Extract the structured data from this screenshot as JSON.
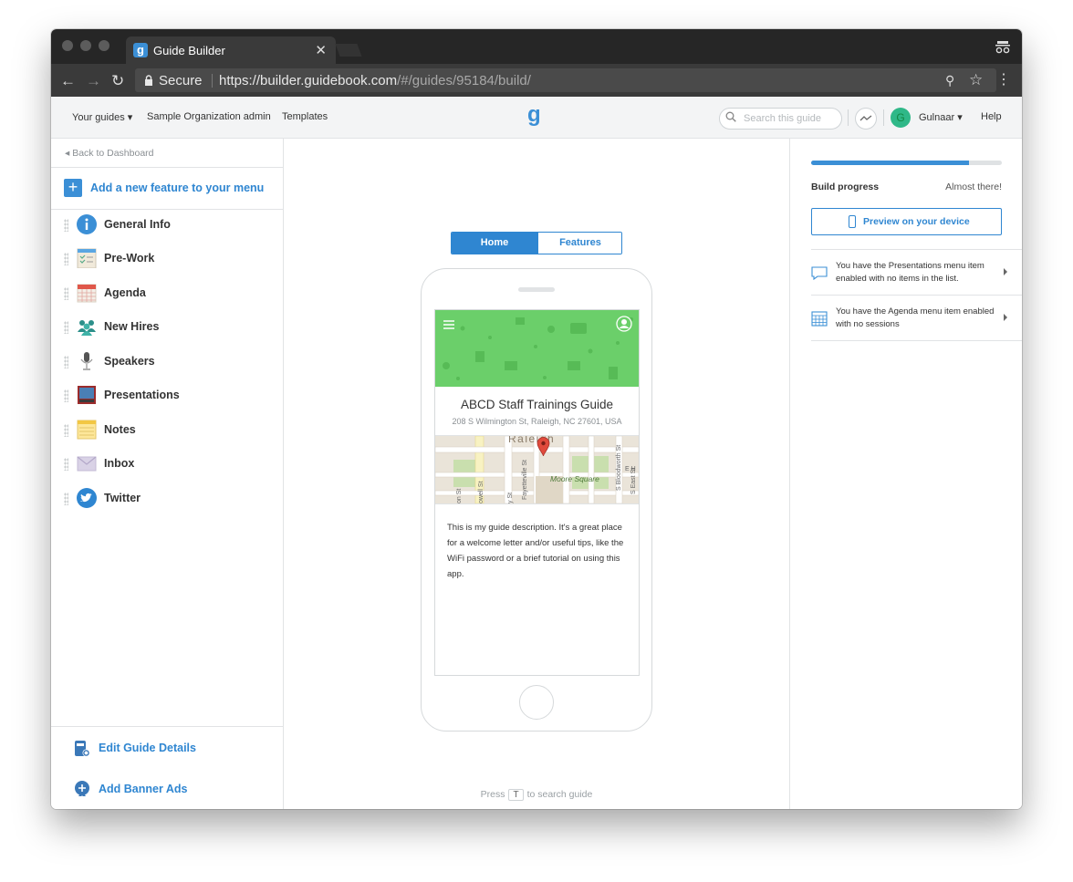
{
  "browser": {
    "tab_title": "Guide Builder",
    "tab_favicon": "g",
    "close_glyph": "✕",
    "secure_label": "Secure",
    "url_main": "https://builder.guidebook.com",
    "url_rest": "/#/guides/95184/build/"
  },
  "header": {
    "your_guides": "Your guides ▾",
    "org_admin": "Sample Organization admin",
    "templates": "Templates",
    "logo": "g",
    "search_placeholder": "Search this guide",
    "avatar_initial": "G",
    "user_name": "Gulnaar ▾",
    "help": "Help"
  },
  "sidebar": {
    "back": "Back to Dashboard",
    "add_feature": "Add a new feature to your menu",
    "items": [
      {
        "label": "General Info",
        "icon": "info-icon"
      },
      {
        "label": "Pre-Work",
        "icon": "checklist-icon"
      },
      {
        "label": "Agenda",
        "icon": "calendar-icon"
      },
      {
        "label": "New Hires",
        "icon": "people-icon"
      },
      {
        "label": "Speakers",
        "icon": "microphone-icon"
      },
      {
        "label": "Presentations",
        "icon": "presentation-icon"
      },
      {
        "label": "Notes",
        "icon": "notepad-icon"
      },
      {
        "label": "Inbox",
        "icon": "envelope-icon"
      },
      {
        "label": "Twitter",
        "icon": "twitter-icon"
      }
    ],
    "edit_details": "Edit Guide Details",
    "add_banner": "Add Banner Ads"
  },
  "center": {
    "tab_home": "Home",
    "tab_features": "Features",
    "guide_title": "ABCD Staff Trainings Guide",
    "guide_address": "208 S Wilmington St, Raleigh, NC 27601, USA",
    "guide_description": "This is my guide description. It's a great place for a welcome letter and/or useful tips, like the WiFi password or a brief tutorial on using this app.",
    "map_labels": {
      "city": "Raleigh",
      "park": "Moore Square",
      "street1": "Fayetteville St",
      "street2": "S Bloodworth St",
      "street3": "owell St",
      "street4": "y St",
      "street5": "on St",
      "street6": "E H",
      "street7": "S East St"
    },
    "press_prefix": "Press",
    "press_key": "T",
    "press_suffix": "to search guide"
  },
  "right": {
    "progress_percent": 83,
    "build_progress_label": "Build progress",
    "build_status": "Almost there!",
    "preview_label": "Preview on your device",
    "notices": [
      {
        "text": "You have the Presentations menu item enabled with no items in the list.",
        "icon": "speech-bubble-icon"
      },
      {
        "text": "You have the Agenda menu item enabled with no sessions",
        "icon": "calendar-grid-icon"
      }
    ]
  },
  "colors": {
    "accent": "#2f86d1",
    "banner_green": "#6bcf6a",
    "avatar_green": "#2fb888"
  }
}
